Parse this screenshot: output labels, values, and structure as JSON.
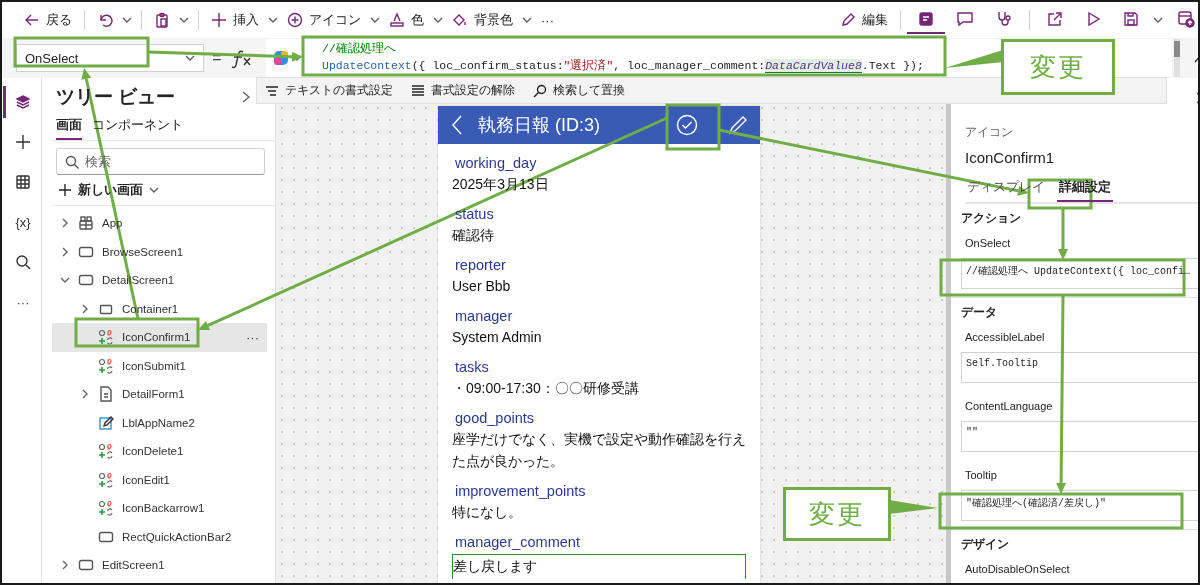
{
  "toolbar": {
    "left": [
      [
        {
          "kind": "back",
          "label": "戻る"
        }
      ],
      [
        {
          "kind": "undo",
          "dropdown": true
        }
      ],
      [
        {
          "kind": "paste",
          "dropdown": true
        }
      ],
      [
        {
          "kind": "insert",
          "label": "挿入",
          "dropdown": true
        },
        {
          "kind": "add-icon",
          "label": "アイコン",
          "dropdown": true
        },
        {
          "kind": "color",
          "label": "色",
          "dropdown": true
        },
        {
          "kind": "fill",
          "label": "背景色",
          "dropdown": true
        },
        {
          "kind": "more",
          "label": "···"
        }
      ]
    ],
    "edit": {
      "label": "編集"
    },
    "right": [
      [
        {
          "kind": "app",
          "selected": true
        },
        {
          "kind": "comment",
          "selected": false
        },
        {
          "kind": "checker",
          "selected": false
        }
      ],
      [
        {
          "kind": "share",
          "selected": false
        },
        {
          "kind": "play",
          "selected": false
        },
        {
          "kind": "save",
          "selected": false,
          "dropdown": true
        },
        {
          "kind": "publish",
          "selected": false
        }
      ]
    ]
  },
  "formula_bar": {
    "property": "OnSelect",
    "operator": "=",
    "lines": [
      [
        {
          "kind": "comment",
          "text": "//確認処理へ"
        }
      ],
      [
        {
          "kind": "function",
          "text": "UpdateContext"
        },
        {
          "kind": "plain",
          "text": "({ loc_confirm_status:"
        },
        {
          "kind": "string",
          "text": "\"選択済\""
        },
        {
          "kind": "plain",
          "text": ", loc_manager_comment:"
        },
        {
          "kind": "reference",
          "text": "DataCardValue8"
        },
        {
          "kind": "plain",
          "text": ".Text });"
        }
      ]
    ],
    "tools": [
      {
        "kind": "format",
        "label": "テキストの書式設定"
      },
      {
        "kind": "clear",
        "label": "書式設定の解除"
      },
      {
        "kind": "search",
        "label": "検索して置換"
      }
    ]
  },
  "rail": [
    {
      "kind": "layers",
      "selected": true
    },
    {
      "kind": "plus",
      "selected": false
    },
    {
      "kind": "table",
      "selected": false
    },
    {
      "kind": "variables",
      "label": "{x}",
      "selected": false
    },
    {
      "kind": "search",
      "selected": false
    },
    {
      "kind": "more",
      "label": "···",
      "selected": false
    }
  ],
  "tree": {
    "title": "ツリー ビュー",
    "tabs": [
      {
        "label": "画面",
        "selected": true
      },
      {
        "label": "コンポーネント",
        "selected": false
      }
    ],
    "search": {
      "placeholder": "検索"
    },
    "new_screen": "新しい画面",
    "items": [
      {
        "kind": "app",
        "label": "App",
        "expanded": false,
        "selected": false
      },
      {
        "kind": "screen",
        "label": "BrowseScreen1",
        "expanded": false,
        "selected": false
      },
      {
        "kind": "screen",
        "label": "DetailScreen1",
        "expanded": true,
        "selected": false,
        "children": [
          {
            "kind": "container",
            "label": "Container1",
            "expanded": false,
            "selected": false
          },
          {
            "kind": "icon",
            "label": "IconConfirm1",
            "selected": true,
            "more": "···"
          },
          {
            "kind": "icon",
            "label": "IconSubmit1",
            "selected": false
          },
          {
            "kind": "form",
            "label": "DetailForm1",
            "expanded": false,
            "selected": false
          },
          {
            "kind": "label",
            "label": "LblAppName2",
            "selected": false
          },
          {
            "kind": "icon",
            "label": "IconDelete1",
            "selected": false
          },
          {
            "kind": "icon",
            "label": "IconEdit1",
            "selected": false
          },
          {
            "kind": "icon",
            "label": "IconBackarrow1",
            "selected": false
          },
          {
            "kind": "rect",
            "label": "RectQuickActionBar2",
            "selected": false
          }
        ]
      },
      {
        "kind": "screen",
        "label": "EditScreen1",
        "expanded": false,
        "selected": false
      }
    ]
  },
  "phone": {
    "title": "執務日報 (ID:3)",
    "fields": [
      {
        "kind": "text",
        "label": "working_day",
        "value": "2025年3月13日"
      },
      {
        "kind": "text",
        "label": "status",
        "value": "確認待"
      },
      {
        "kind": "text",
        "label": "reporter",
        "value": "User Bbb"
      },
      {
        "kind": "text",
        "label": "manager",
        "value": "System Admin"
      },
      {
        "kind": "text",
        "label": "tasks",
        "value": "・09:00-17:30：〇〇研修受講"
      },
      {
        "kind": "text",
        "label": "good_points",
        "value": "座学だけでなく、実機で設定や動作確認を行えた点が良かった。"
      },
      {
        "kind": "text",
        "label": "improvement_points",
        "value": "特になし。"
      },
      {
        "kind": "input",
        "label": "manager_comment",
        "value": "差し戻します"
      }
    ]
  },
  "properties": {
    "type_label": "アイコン",
    "name": "IconConfirm1",
    "tabs": [
      {
        "label": "ディスプレイ",
        "selected": false
      },
      {
        "label": "詳細設定",
        "selected": true
      }
    ],
    "sections": [
      {
        "title": "アクション",
        "properties": [
          {
            "label": "OnSelect",
            "value": "//確認処理へ UpdateContext({ loc_confi…"
          }
        ]
      },
      {
        "title": "データ",
        "properties": [
          {
            "label": "AccessibleLabel",
            "value": "Self.Tooltip"
          },
          {
            "label": "ContentLanguage",
            "value": "\"\""
          },
          {
            "label": "Tooltip",
            "value": "\"確認処理へ(確認済/差戻し)\""
          }
        ]
      },
      {
        "title": "デザイン",
        "properties": [
          {
            "label": "AutoDisableOnSelect"
          }
        ]
      }
    ]
  },
  "annotations": {
    "callouts": [
      "変更",
      "変更"
    ]
  }
}
